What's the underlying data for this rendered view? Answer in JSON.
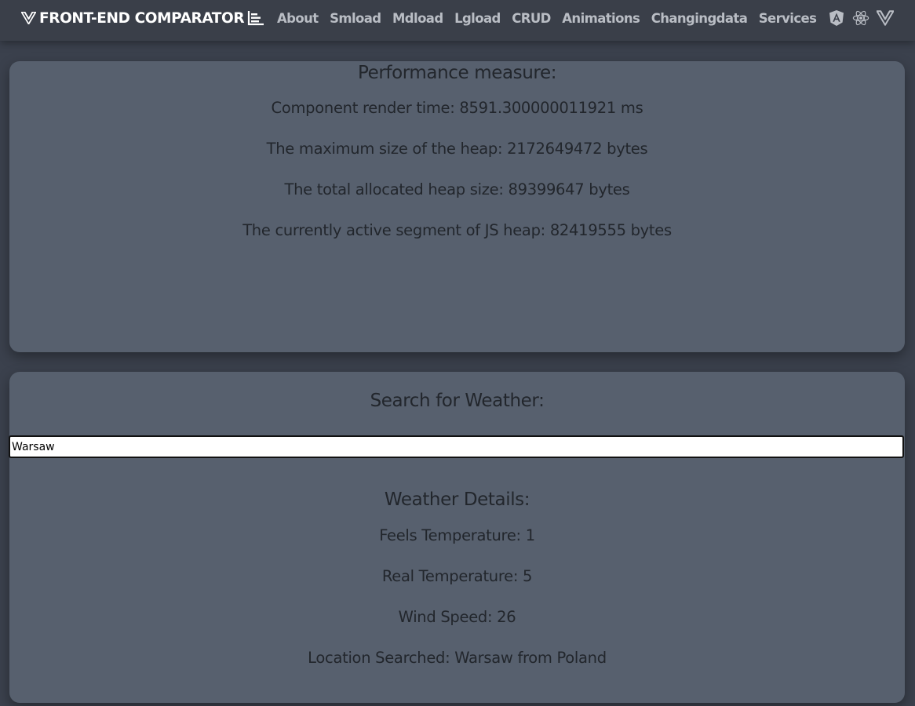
{
  "nav": {
    "brand": "FRONT-END COMPARATOR",
    "brand_icon": "vue-logo-icon",
    "brand_suffix_icon": "bar-chart-icon",
    "links": [
      "About",
      "Smload",
      "Mdload",
      "Lgload",
      "CRUD",
      "Animations",
      "Changingdata",
      "Services"
    ],
    "framework_icons": [
      "angular-logo-icon",
      "react-logo-icon",
      "vue-logo-icon"
    ]
  },
  "performance": {
    "title": "Performance measure:",
    "render_time": "Component render time: 8591.300000011921 ms",
    "heap_max": "The maximum size of the heap: 2172649472 bytes",
    "heap_total": "The total allocated heap size: 89399647 bytes",
    "heap_active": "The currently active segment of JS heap: 82419555 bytes"
  },
  "weather": {
    "search_title": "Search for Weather:",
    "search_value": "Warsaw",
    "details_title": "Weather Details:",
    "feels": "Feels Temperature: 1",
    "real": "Real Temperature: 5",
    "wind": "Wind Speed: 26",
    "location": "Location Searched: Warsaw from Poland"
  },
  "colors": {
    "navbar": "#3a3f49",
    "page_background": "#3b414d",
    "card": "#57606e",
    "text": "#22262c",
    "nav_link": "#b9bdc4"
  }
}
